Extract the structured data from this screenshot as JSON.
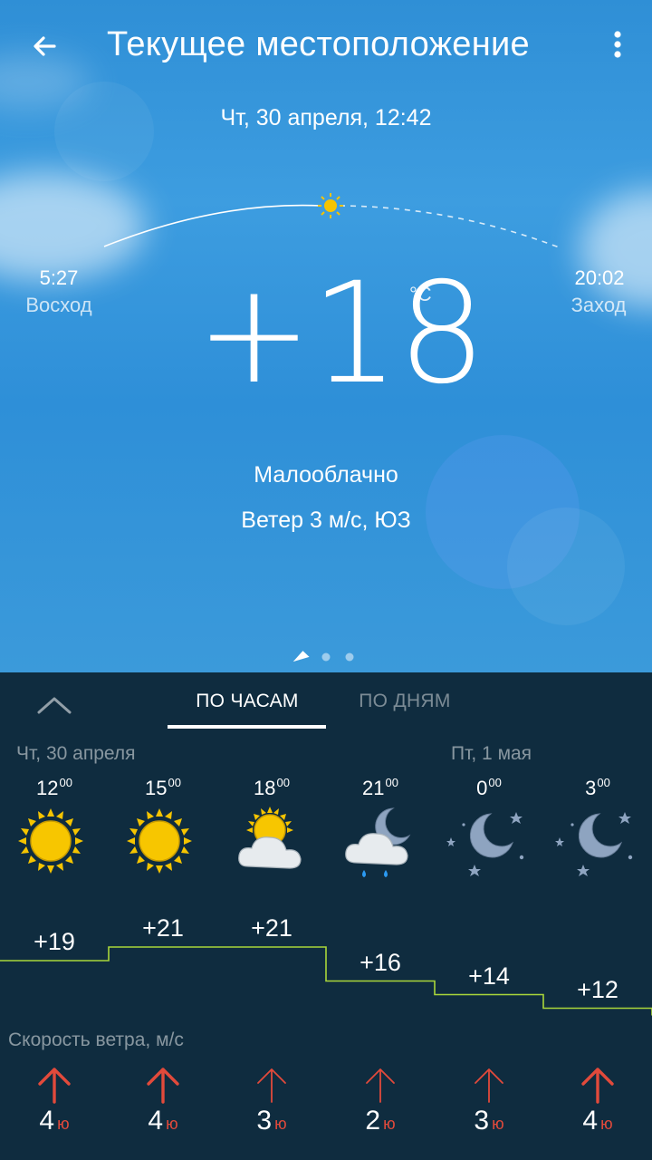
{
  "header": {
    "title": "Текущее местоположение"
  },
  "current": {
    "datetime": "Чт, 30 апреля, 12:42",
    "sunrise_time": "5:27",
    "sunrise_label": "Восход",
    "sunset_time": "20:02",
    "sunset_label": "Заход",
    "temperature": "+18",
    "unit": "°C",
    "condition": "Малооблачно",
    "wind": "Ветер 3 м/с, ЮЗ"
  },
  "tabs": {
    "hourly": "ПО ЧАСАМ",
    "daily": "ПО ДНЯМ"
  },
  "days": {
    "first": "Чт, 30 апреля",
    "second": "Пт, 1 мая"
  },
  "hourly": [
    {
      "hour": "12",
      "min": "00",
      "icon": "sun-icon",
      "temp": "+19",
      "wind_speed": "4",
      "wind_dir": "ю"
    },
    {
      "hour": "15",
      "min": "00",
      "icon": "sun-icon",
      "temp": "+21",
      "wind_speed": "4",
      "wind_dir": "ю"
    },
    {
      "hour": "18",
      "min": "00",
      "icon": "partly-cloudy-icon",
      "temp": "+21",
      "wind_speed": "3",
      "wind_dir": "ю"
    },
    {
      "hour": "21",
      "min": "00",
      "icon": "night-rain-icon",
      "temp": "+16",
      "wind_speed": "2",
      "wind_dir": "ю"
    },
    {
      "hour": "0",
      "min": "00",
      "icon": "moon-stars-icon",
      "temp": "+14",
      "wind_speed": "3",
      "wind_dir": "ю"
    },
    {
      "hour": "3",
      "min": "00",
      "icon": "moon-stars-icon",
      "temp": "+12",
      "wind_speed": "4",
      "wind_dir": "ю"
    }
  ],
  "wind_section_title": "Скорость ветра, м/с",
  "colors": {
    "sky": "#3d9de0",
    "panel": "#0f2c3f",
    "temp_line": "#a9d63a",
    "wind_arrow": "#e24a3b",
    "sun": "#f5c400"
  }
}
